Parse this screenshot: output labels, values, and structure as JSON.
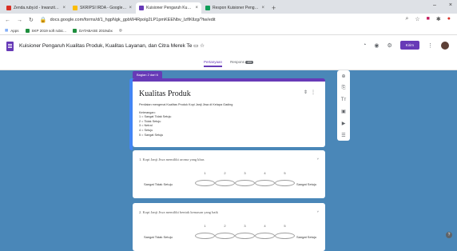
{
  "browser": {
    "tabs": [
      {
        "title": "Zenda.ruby.id - Irwanzitb@gmi...",
        "color": "#d93025",
        "active": false
      },
      {
        "title": "SKRIPSI IRDA - Google Drive",
        "color": "#fbbc04",
        "active": false
      },
      {
        "title": "Kuisioner Pengaruh Kualitas Prod...",
        "color": "#673ab7",
        "active": true
      },
      {
        "title": "Respon Kuisioner Pengaruh Kual...",
        "color": "#0f9d58",
        "active": false
      }
    ],
    "new_tab": "+",
    "window_controls": [
      "–",
      "×"
    ],
    "url": "docs.google.com/forms/d/1_hgpNgk_gpbW4Rpolg2LP1pmKEENbv_IzfIKllzg/?tw/edit",
    "bookmarks": [
      {
        "label": "Apps"
      },
      {
        "label": "SKP 2019 soft rubic..."
      },
      {
        "label": "DATABASE 2019ubx"
      }
    ]
  },
  "form_app": {
    "title": "Kuisioner Pengaruh Kualitas Produk, Kualitas Layanan, dan Citra Merek Te",
    "send_label": "Kirim",
    "tabs": [
      {
        "label": "Pertanyaan"
      },
      {
        "label": "Respons",
        "count": "100"
      }
    ]
  },
  "section": {
    "tag": "Bagian 2 dari 6",
    "title": "Kualitas Produk",
    "desc_line1": "Penilaian mengenai Kualitas Produk Kopi Janji Jiwa di Kelapa Gading",
    "desc_line2": "Keterangan:",
    "scale_items": [
      "1 = Sangat Tidak Setuju",
      "2 = Tidak Setuju",
      "3 = Netral",
      "4 = Setuju",
      "5 = Sangat Setuju"
    ]
  },
  "questions": [
    {
      "text": "1. Kopi Janji Jiwa memiliki aroma yang khas",
      "scale": [
        "1",
        "2",
        "3",
        "4",
        "5"
      ],
      "low_label": "Sangat Tidak Setuju",
      "high_label": "Sangat Setuju"
    },
    {
      "text": "2. Kopi Janji Jiwa memiliki bentuk kemasan yang baik",
      "scale": [
        "1",
        "2",
        "3",
        "4",
        "5"
      ],
      "low_label": "Sangat Tidak Setuju",
      "high_label": "Sangat Setuju"
    }
  ]
}
